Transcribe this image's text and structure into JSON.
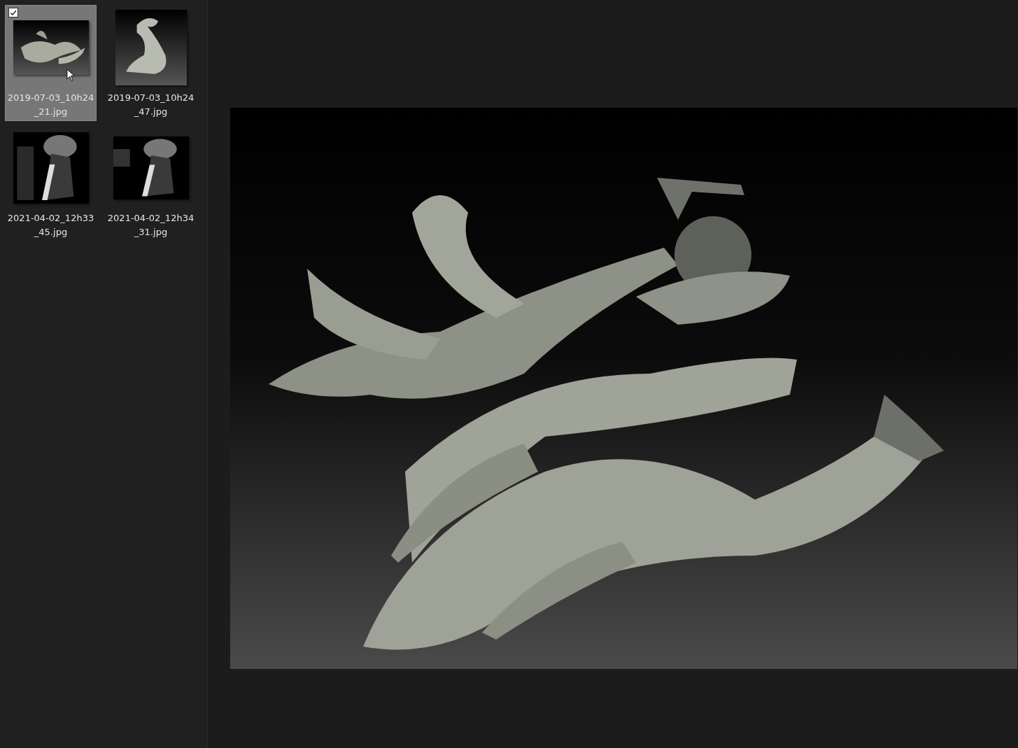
{
  "files": [
    {
      "name": "2019-07-03_10h24_21.jpg",
      "selected": true,
      "checked": true
    },
    {
      "name": "2019-07-03_10h24_47.jpg",
      "selected": false,
      "checked": false
    },
    {
      "name": "2021-04-02_12h33_45.jpg",
      "selected": false,
      "checked": false
    },
    {
      "name": "2021-04-02_12h34_31.jpg",
      "selected": false,
      "checked": false
    }
  ]
}
